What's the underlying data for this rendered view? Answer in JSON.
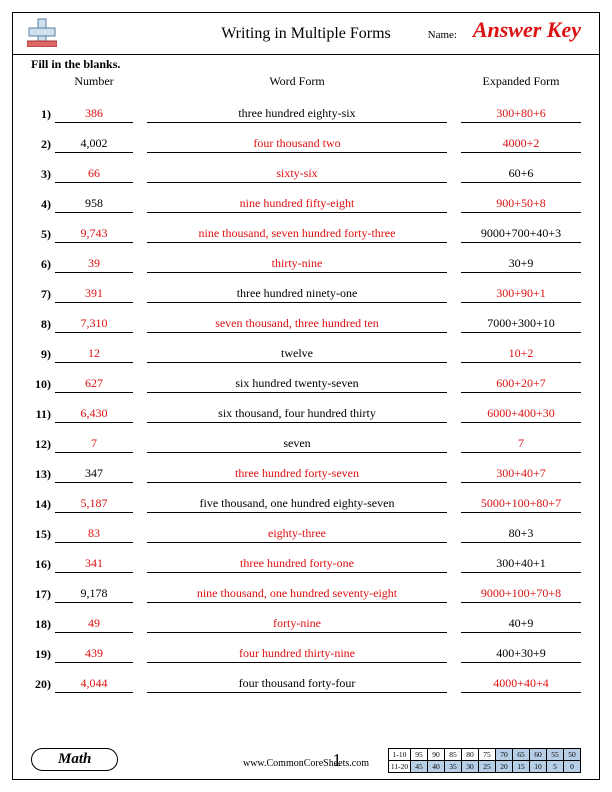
{
  "header": {
    "title": "Writing in Multiple Forms",
    "name_label": "Name:",
    "answer_key": "Answer Key"
  },
  "instructions": "Fill in the blanks.",
  "columns": {
    "number": "Number",
    "word": "Word Form",
    "expanded": "Expanded Form"
  },
  "rows": [
    {
      "n": "1)",
      "number": "386",
      "word": "three hundred eighty-six",
      "expanded": "300+80+6",
      "answers": [
        "number",
        "expanded"
      ]
    },
    {
      "n": "2)",
      "number": "4,002",
      "word": "four thousand two",
      "expanded": "4000+2",
      "answers": [
        "word",
        "expanded"
      ]
    },
    {
      "n": "3)",
      "number": "66",
      "word": "sixty-six",
      "expanded": "60+6",
      "answers": [
        "number",
        "word"
      ]
    },
    {
      "n": "4)",
      "number": "958",
      "word": "nine hundred fifty-eight",
      "expanded": "900+50+8",
      "answers": [
        "word",
        "expanded"
      ]
    },
    {
      "n": "5)",
      "number": "9,743",
      "word": "nine thousand, seven hundred forty-three",
      "expanded": "9000+700+40+3",
      "answers": [
        "number",
        "word"
      ]
    },
    {
      "n": "6)",
      "number": "39",
      "word": "thirty-nine",
      "expanded": "30+9",
      "answers": [
        "number",
        "word"
      ]
    },
    {
      "n": "7)",
      "number": "391",
      "word": "three hundred ninety-one",
      "expanded": "300+90+1",
      "answers": [
        "number",
        "expanded"
      ]
    },
    {
      "n": "8)",
      "number": "7,310",
      "word": "seven thousand, three hundred ten",
      "expanded": "7000+300+10",
      "answers": [
        "number",
        "word"
      ]
    },
    {
      "n": "9)",
      "number": "12",
      "word": "twelve",
      "expanded": "10+2",
      "answers": [
        "number",
        "expanded"
      ]
    },
    {
      "n": "10)",
      "number": "627",
      "word": "six hundred twenty-seven",
      "expanded": "600+20+7",
      "answers": [
        "number",
        "expanded"
      ]
    },
    {
      "n": "11)",
      "number": "6,430",
      "word": "six thousand, four hundred thirty",
      "expanded": "6000+400+30",
      "answers": [
        "number",
        "expanded"
      ]
    },
    {
      "n": "12)",
      "number": "7",
      "word": "seven",
      "expanded": "7",
      "answers": [
        "number",
        "expanded"
      ]
    },
    {
      "n": "13)",
      "number": "347",
      "word": "three hundred forty-seven",
      "expanded": "300+40+7",
      "answers": [
        "word",
        "expanded"
      ]
    },
    {
      "n": "14)",
      "number": "5,187",
      "word": "five thousand, one hundred eighty-seven",
      "expanded": "5000+100+80+7",
      "answers": [
        "number",
        "expanded"
      ]
    },
    {
      "n": "15)",
      "number": "83",
      "word": "eighty-three",
      "expanded": "80+3",
      "answers": [
        "number",
        "word"
      ]
    },
    {
      "n": "16)",
      "number": "341",
      "word": "three hundred forty-one",
      "expanded": "300+40+1",
      "answers": [
        "number",
        "word"
      ]
    },
    {
      "n": "17)",
      "number": "9,178",
      "word": "nine thousand, one hundred seventy-eight",
      "expanded": "9000+100+70+8",
      "answers": [
        "word",
        "expanded"
      ]
    },
    {
      "n": "18)",
      "number": "49",
      "word": "forty-nine",
      "expanded": "40+9",
      "answers": [
        "number",
        "word"
      ]
    },
    {
      "n": "19)",
      "number": "439",
      "word": "four hundred thirty-nine",
      "expanded": "400+30+9",
      "answers": [
        "number",
        "word"
      ]
    },
    {
      "n": "20)",
      "number": "4,044",
      "word": "four thousand forty-four",
      "expanded": "4000+40+4",
      "answers": [
        "number",
        "expanded"
      ]
    }
  ],
  "footer": {
    "subject": "Math",
    "url": "www.CommonCoreSheets.com",
    "page": "1",
    "score": {
      "row1_label": "1-10",
      "row2_label": "11-20",
      "row1": [
        "95",
        "90",
        "85",
        "80",
        "75",
        "70",
        "65",
        "60",
        "55",
        "50"
      ],
      "row2": [
        "45",
        "40",
        "35",
        "30",
        "25",
        "20",
        "15",
        "10",
        "5",
        "0"
      ],
      "row1_shade_from": 5,
      "row2_shade_from": 0
    }
  }
}
